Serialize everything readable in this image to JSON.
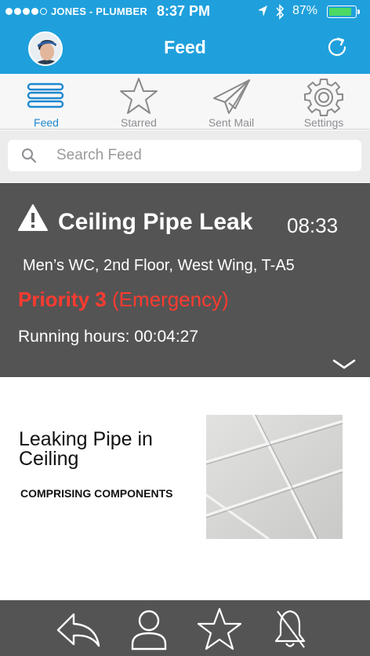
{
  "status_bar": {
    "carrier": "JONES - PLUMBER",
    "time": "8:37 PM",
    "battery_percent": "87%",
    "battery_level": 0.87,
    "signal_bars_filled": 4,
    "signal_bars_total": 5
  },
  "header": {
    "title": "Feed",
    "left_icon": "user-avatar",
    "right_icon": "refresh-icon"
  },
  "tabs": [
    {
      "label": "Feed",
      "icon": "list-icon",
      "active": true
    },
    {
      "label": "Starred",
      "icon": "star-icon",
      "active": false
    },
    {
      "label": "Sent Mail",
      "icon": "paper-plane-icon",
      "active": false
    },
    {
      "label": "Settings",
      "icon": "gear-icon",
      "active": false
    }
  ],
  "search": {
    "placeholder": "Search Feed",
    "value": ""
  },
  "alert": {
    "title": "Ceiling Pipe Leak",
    "time": "08:33",
    "location": "Men’s WC, 2nd Floor, West Wing, T-A5",
    "priority": "Priority 3",
    "priority_label": "(Emergency)",
    "running_label": "Running hours:",
    "running_value": "00:04:27"
  },
  "detail": {
    "title": "Leaking Pipe in Ceiling",
    "subtitle": "COMPRISING COMPONENTS"
  },
  "bottom_toolbar": [
    "back-arrow-icon",
    "person-icon",
    "star-icon",
    "bell-off-icon"
  ],
  "colors": {
    "header_blue": "#1fa0dc",
    "tab_active": "#1e88d0",
    "card_gray": "#545454",
    "priority_red": "#ff3b30",
    "battery_green": "#4cd964"
  }
}
